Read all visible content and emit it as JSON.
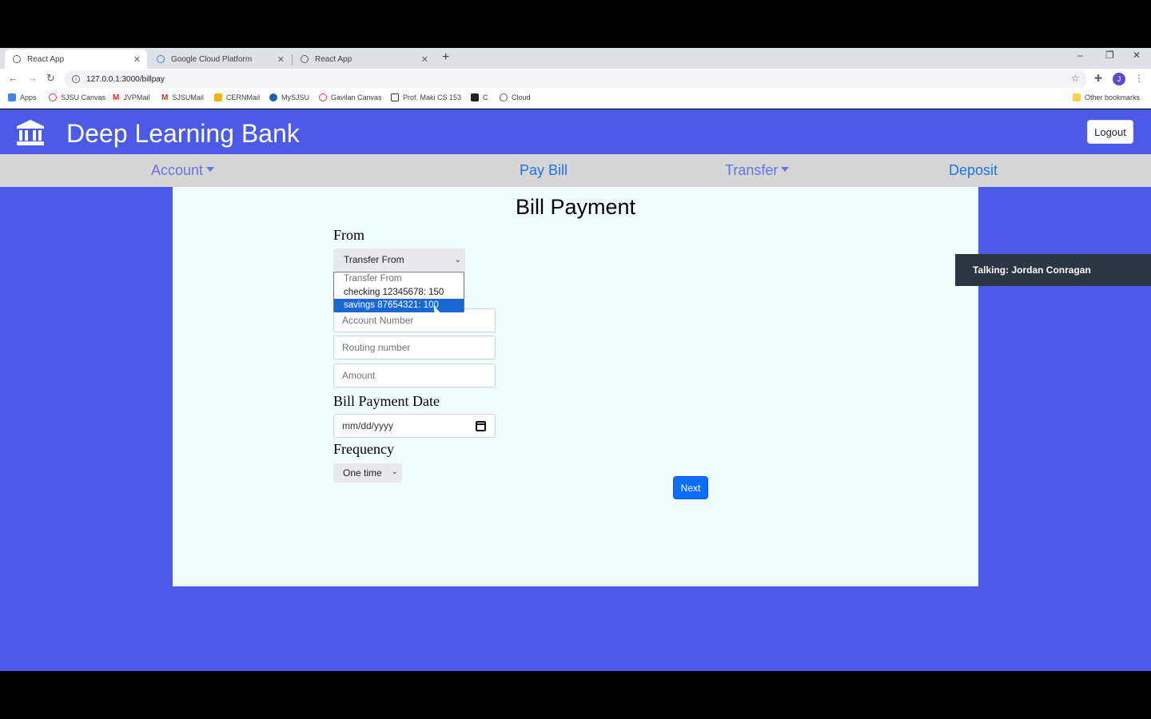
{
  "browser": {
    "tabs": [
      {
        "title": "React App",
        "active": true
      },
      {
        "title": "Google Cloud Platform",
        "active": false
      },
      {
        "title": "React App",
        "active": false
      }
    ],
    "url": "127.0.0.1:3000/billpay",
    "bookmarks": [
      "Apps",
      "SJSU Canvas",
      "JVPMail",
      "SJSUMail",
      "CERNMail",
      "MySJSU",
      "Gavilan Canvas",
      "Prof. Maki CS 153",
      "C",
      "Cloud"
    ],
    "other_bookmarks": "Other bookmarks",
    "profile_initial": "J"
  },
  "app": {
    "brand": "Deep Learning Bank",
    "logout_label": "Logout",
    "nav": {
      "account": "Account",
      "pay_bill": "Pay Bill",
      "transfer": "Transfer",
      "deposit": "Deposit"
    },
    "colors": {
      "primary": "#4b5be8",
      "panel": "#f0ffff",
      "button": "#0d6efd"
    }
  },
  "form": {
    "title": "Bill Payment",
    "from_label": "From",
    "from_value": "Transfer From",
    "from_options": [
      {
        "label": "Transfer From",
        "state": "disabled"
      },
      {
        "label": "checking 12345678: 150",
        "state": "normal"
      },
      {
        "label": "savings 87654321: 100",
        "state": "highlighted"
      }
    ],
    "account_placeholder": "Account Number",
    "routing_placeholder": "Routing number",
    "amount_placeholder": "Amount",
    "date_label": "Bill Payment Date",
    "date_placeholder": "mm/dd/yyyy",
    "frequency_label": "Frequency",
    "frequency_value": "One time",
    "next_label": "Next"
  },
  "overlay": {
    "talking": "Talking: Jordan Conragan"
  }
}
